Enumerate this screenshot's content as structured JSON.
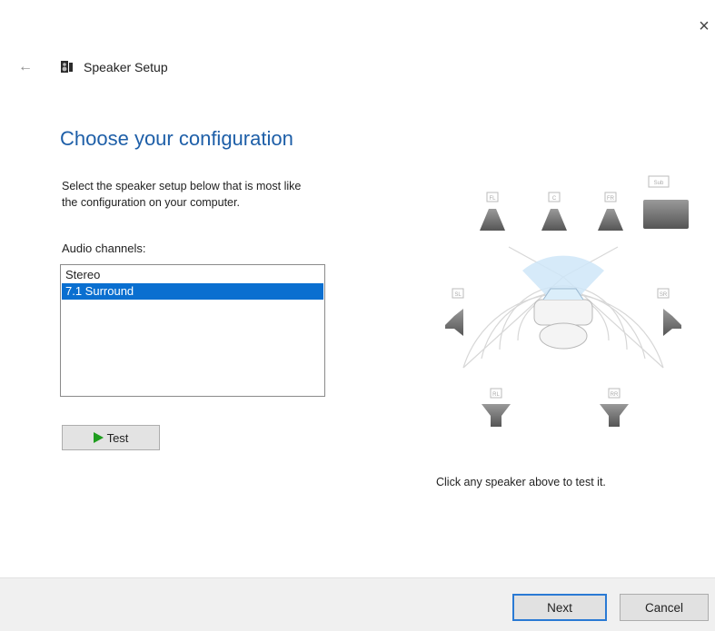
{
  "window": {
    "close_glyph": "×",
    "back_glyph": "←"
  },
  "header": {
    "title": "Speaker Setup",
    "icon": "speaker-setup-icon"
  },
  "main": {
    "heading": "Choose your configuration",
    "instructions_line1": "Select the speaker setup below that is most like",
    "instructions_line2": "the configuration on your computer.",
    "channels_label": "Audio channels:",
    "channels": [
      {
        "label": "Stereo",
        "selected": false
      },
      {
        "label": "7.1 Surround",
        "selected": true
      }
    ],
    "test_button": "Test"
  },
  "diagram": {
    "speakers": [
      {
        "id": "FL",
        "label": "FL"
      },
      {
        "id": "C",
        "label": "C"
      },
      {
        "id": "FR",
        "label": "FR"
      },
      {
        "id": "SUB",
        "label": "Sub"
      },
      {
        "id": "SL",
        "label": "SL"
      },
      {
        "id": "SR",
        "label": "SR"
      },
      {
        "id": "RL",
        "label": "RL"
      },
      {
        "id": "RR",
        "label": "RR"
      }
    ],
    "hint": "Click any speaker above to test it."
  },
  "footer": {
    "next_label": "Next",
    "cancel_label": "Cancel"
  },
  "colors": {
    "accent": "#1e5fa8",
    "selection": "#0a6fd0",
    "test_play": "#1f9d1f"
  }
}
